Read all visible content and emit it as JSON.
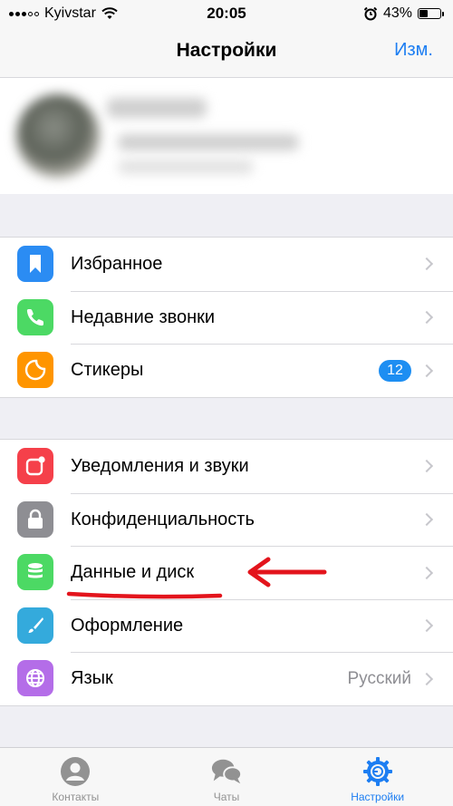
{
  "status_bar": {
    "carrier": "Kyivstar",
    "time": "20:05",
    "battery_percent": "43%",
    "battery_level": 0.43,
    "icons": [
      "signal-icon",
      "wifi-icon",
      "alarm-icon",
      "battery-icon"
    ]
  },
  "nav": {
    "title": "Настройки",
    "edit_label": "Изм."
  },
  "groups": [
    {
      "items": [
        {
          "label": "Избранное",
          "icon": "bookmark-icon",
          "color": "#2b8cf3"
        },
        {
          "label": "Недавние звонки",
          "icon": "phone-icon",
          "color": "#4cd964"
        },
        {
          "label": "Стикеры",
          "icon": "sticker-icon",
          "color": "#ff9500",
          "badge": "12"
        }
      ]
    },
    {
      "items": [
        {
          "label": "Уведомления и звуки",
          "icon": "notifications-icon",
          "color": "#f5404a"
        },
        {
          "label": "Конфиденциальность",
          "icon": "lock-icon",
          "color": "#8e8e93"
        },
        {
          "label": "Данные и диск",
          "icon": "database-icon",
          "color": "#4cd964"
        },
        {
          "label": "Оформление",
          "icon": "brush-icon",
          "color": "#34aadc"
        },
        {
          "label": "Язык",
          "icon": "globe-icon",
          "color": "#b46de8",
          "value": "Русский"
        }
      ]
    }
  ],
  "tabs": [
    {
      "label": "Контакты",
      "icon": "contact-icon"
    },
    {
      "label": "Чаты",
      "icon": "chats-icon"
    },
    {
      "label": "Настройки",
      "icon": "settings-icon",
      "active": true
    }
  ],
  "colors": {
    "accent": "#1d7ef2",
    "annotation": "#e3141c"
  }
}
